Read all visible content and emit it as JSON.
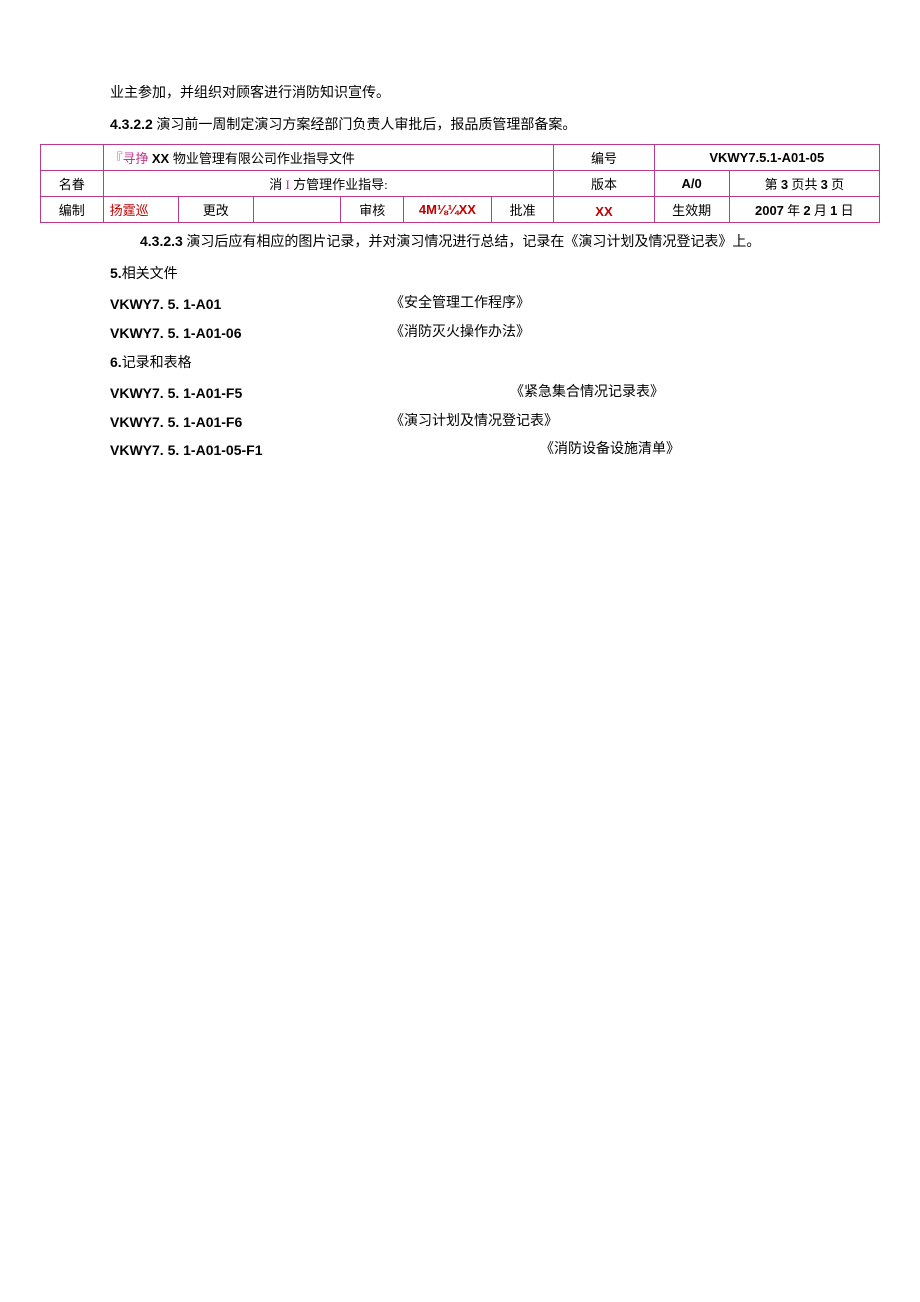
{
  "para1": "业主参加，并组织对顾客进行消防知识宣传。",
  "para2_num": "4.3.2.2",
  "para2_text": " 演习前一周制定演习方案经部门负责人审批后，报品质管理部备案。",
  "table": {
    "row1": {
      "cell1": "",
      "cell2": "『寻挣 XX 物业管理有限公司作业指导文件",
      "cell3": "编号",
      "cell4": "VKWY7.5.1-A01-05"
    },
    "row2": {
      "cell1": "名眷",
      "cell2": "消 I 方管理作业指导:",
      "cell3": "版本",
      "cell4": "A/0",
      "cell5": "第 3 页共 3 页"
    },
    "row3": {
      "cell1": "编制",
      "cell2": "扬霆巡",
      "cell3": "更改",
      "cell4": "",
      "cell5": "审核",
      "cell6": "4M⅛¼XX",
      "cell7": "批准",
      "cell8": "XX",
      "cell9": "生效期",
      "cell10": "2007 年 2 月 1 日"
    }
  },
  "para3_num": "4.3.2.3",
  "para3_text": " 演习后应有相应的图片记录，并对演习情况进行总结，记录在《演习计划及情况登记表》上。",
  "section5_num": "5.",
  "section5_title": "相关文件",
  "doc1_code": "VKWY7. 5. 1-A01",
  "doc1_name": "《安全管理工作程序》",
  "doc2_code": "VKWY7. 5. 1-A01-06",
  "doc2_name": "《消防灭火操作办法》",
  "section6_num": "6.",
  "section6_title": "记录和表格",
  "doc3_code": "VKWY7. 5. 1-A01-F5",
  "doc3_name": "《紧急集合情况记录表》",
  "doc4_code": "VKWY7. 5. 1-A01-F6",
  "doc4_name": "《演习计划及情况登记表》",
  "doc5_code": "VKWY7. 5. 1-A01-05-F1",
  "doc5_name": "《消防设备设施清单》"
}
